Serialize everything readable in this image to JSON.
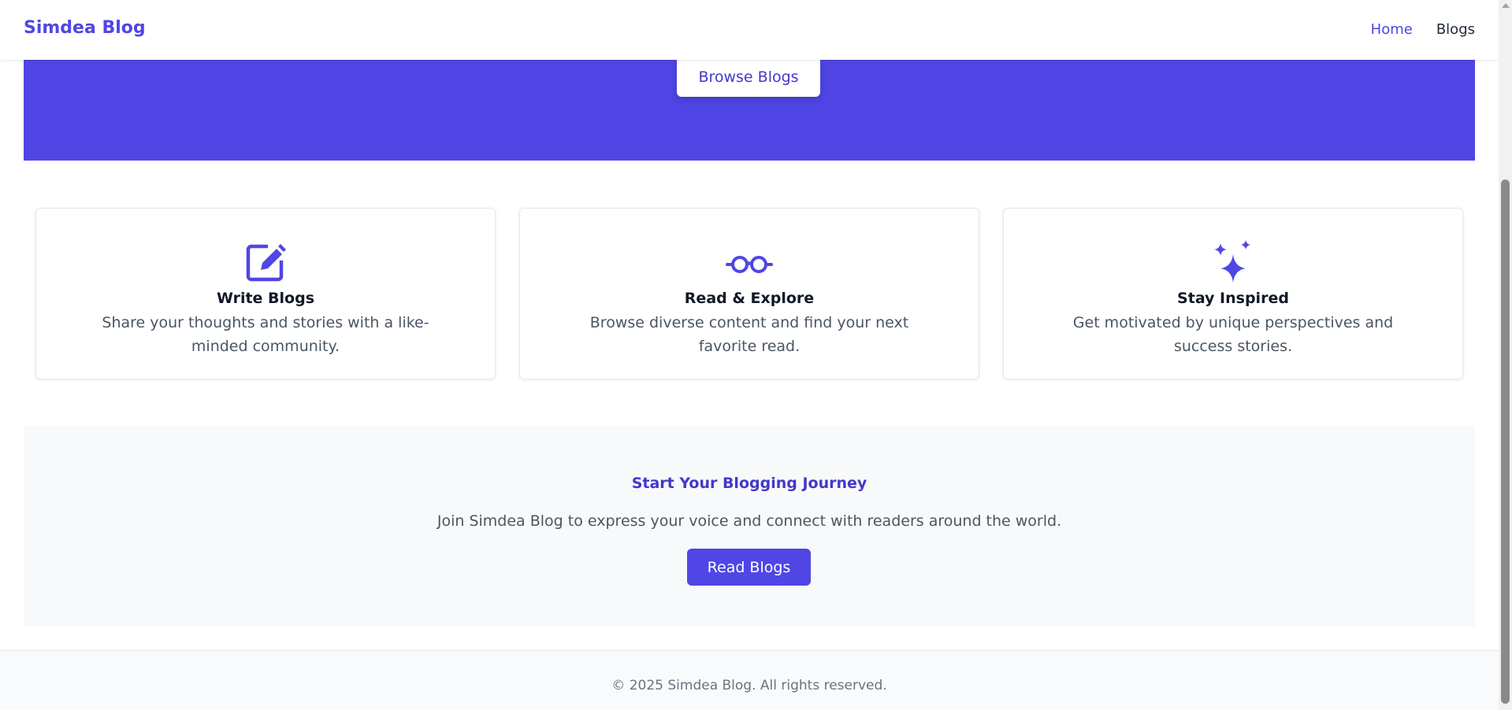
{
  "colors": {
    "accent": "#4f46e5",
    "accent_dark": "#4338ca",
    "cta_bg": "#f8f9fa"
  },
  "navbar": {
    "brand": "Simdea Blog",
    "links": [
      {
        "label": "Home",
        "active": true
      },
      {
        "label": "Blogs",
        "active": false
      }
    ]
  },
  "hero": {
    "button_label": "Browse Blogs"
  },
  "features": [
    {
      "icon": "pencil-square-icon",
      "title": "Write Blogs",
      "description": "Share your thoughts and stories with a like-minded community."
    },
    {
      "icon": "eyeglasses-icon",
      "title": "Read & Explore",
      "description": "Browse diverse content and find your next favorite read."
    },
    {
      "icon": "sparkles-icon",
      "title": "Stay Inspired",
      "description": "Get motivated by unique perspectives and success stories."
    }
  ],
  "cta": {
    "title": "Start Your Blogging Journey",
    "text": "Join Simdea Blog to express your voice and connect with readers around the world.",
    "button_label": "Read Blogs"
  },
  "footer": {
    "text": "© 2025 Simdea Blog. All rights reserved."
  }
}
